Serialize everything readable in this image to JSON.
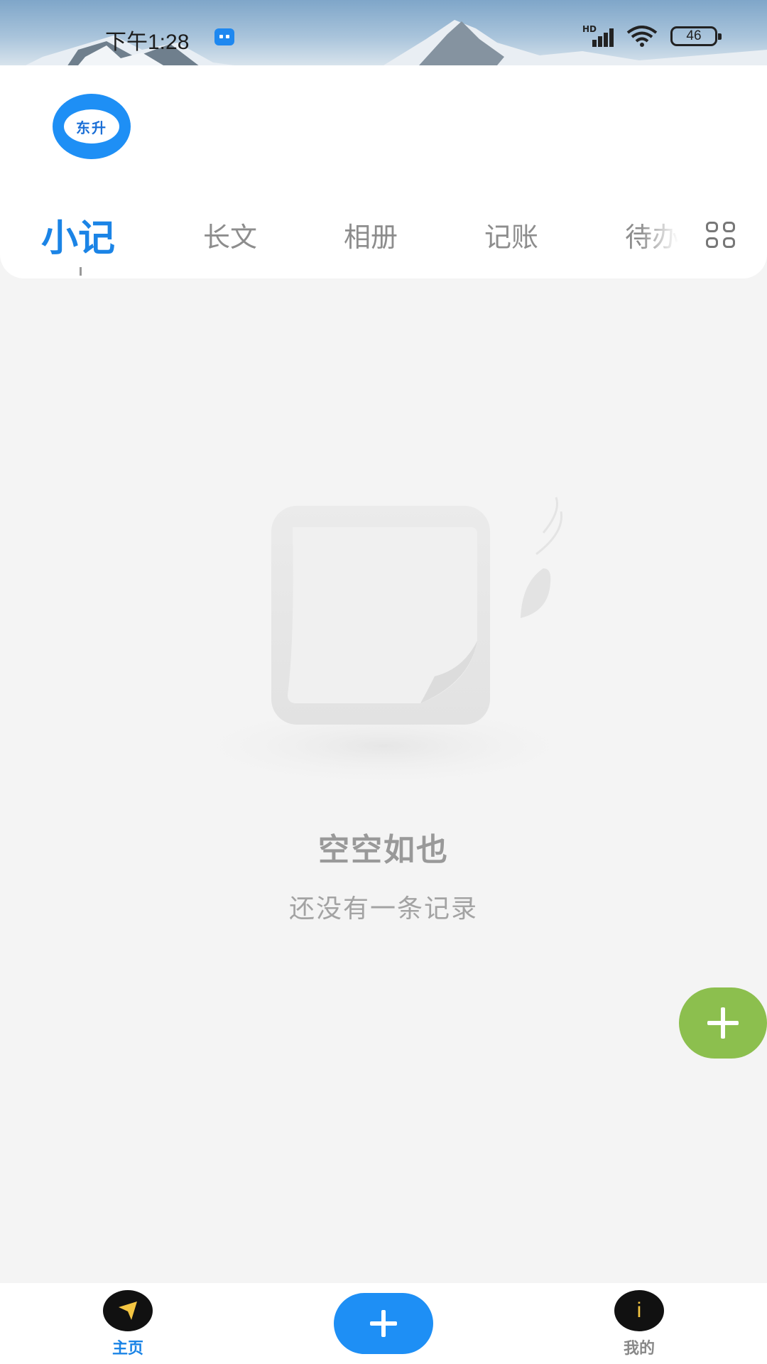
{
  "status_bar": {
    "time": "下午1:28",
    "network_label": "HD",
    "battery": "46"
  },
  "profile": {
    "avatar_text": "东升"
  },
  "tabs": [
    {
      "label": "小记",
      "active": true
    },
    {
      "label": "长文",
      "active": false
    },
    {
      "label": "相册",
      "active": false
    },
    {
      "label": "记账",
      "active": false
    },
    {
      "label": "待办",
      "active": false
    }
  ],
  "empty_state": {
    "title": "空空如也",
    "subtitle": "还没有一条记录"
  },
  "bottom_nav": {
    "home_label": "主页",
    "profile_label": "我的",
    "profile_icon_glyph": "i"
  },
  "colors": {
    "accent": "#1b84e6",
    "fab": "#8cbf4e",
    "nav_add": "#1e8ff5",
    "nav_active_label": "#1b84e6",
    "nav_inactive_label": "#888888"
  },
  "icons": {
    "grid": "grid-icon",
    "fab": "plus-icon",
    "home": "send-arrow-icon",
    "profile": "info-icon"
  }
}
